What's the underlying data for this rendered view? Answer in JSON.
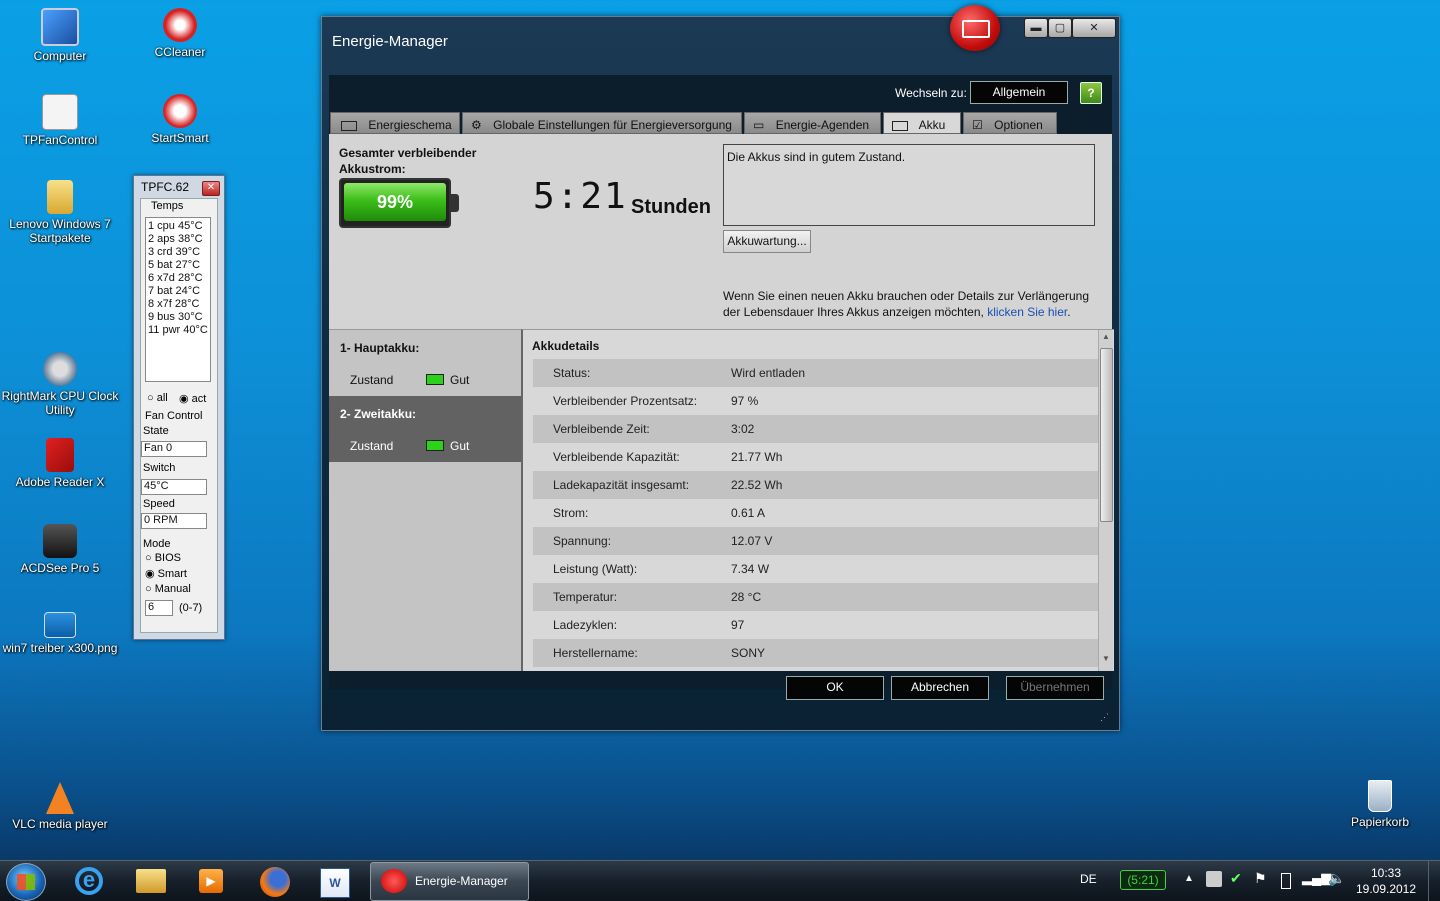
{
  "desktop": {
    "icons": [
      {
        "label": "Computer"
      },
      {
        "label": "CCleaner"
      },
      {
        "label": "TPFanControl"
      },
      {
        "label": "StartSmart"
      },
      {
        "label": "Lenovo Windows 7 Startpakete"
      },
      {
        "label": "RightMark CPU Clock Utility"
      },
      {
        "label": "Adobe Reader X"
      },
      {
        "label": "ACDSee Pro 5"
      },
      {
        "label": "win7 treiber x300.png"
      },
      {
        "label": "VLC media player"
      },
      {
        "label": "Papierkorb"
      }
    ]
  },
  "tpfc": {
    "title": "TPFC.62",
    "temps_label": "Temps",
    "temps": [
      "1 cpu 45°C",
      "2 aps 38°C",
      "3 crd 39°C",
      "5 bat 27°C",
      "6 x7d 28°C",
      "7 bat 24°C",
      "8 x7f 28°C",
      "9 bus 30°C",
      "11 pwr 40°C"
    ],
    "opt_all": "all",
    "opt_act": "act",
    "fan_control_label": "Fan Control",
    "state_label": "State",
    "state_value": "Fan 0",
    "switch_label": "Switch",
    "switch_value": "45°C",
    "speed_label": "Speed",
    "speed_value": "0 RPM",
    "mode_label": "Mode",
    "mode_bios": "BIOS",
    "mode_smart": "Smart",
    "mode_manual": "Manual",
    "manual_value": "6",
    "manual_range": "(0-7)"
  },
  "energy": {
    "title": "Energie-Manager",
    "switch_label": "Wechseln zu:",
    "switch_button": "Allgemein",
    "tabs": [
      {
        "label": "Energieschema"
      },
      {
        "label": "Globale Einstellungen für Energieversorgung"
      },
      {
        "label": "Energie-Agenden"
      },
      {
        "label": "Akku"
      },
      {
        "label": "Optionen"
      }
    ],
    "remaining_label": "Gesamter verbleibender Akkustrom:",
    "battery_percent": "99%",
    "time": "5:21",
    "time_unit": "Stunden",
    "status_text": "Die Akkus sind in gutem Zustand.",
    "maintenance_button": "Akkuwartung...",
    "info_text": "Wenn Sie einen neuen Akku brauchen oder Details zur Verlängerung der Lebensdauer Ihres Akkus anzeigen möchten,",
    "info_link": "klicken Sie hier",
    "batteries": [
      {
        "name": "1- Hauptakku:",
        "state_label": "Zustand",
        "state_value": "Gut"
      },
      {
        "name": "2- Zweitakku:",
        "state_label": "Zustand",
        "state_value": "Gut"
      }
    ],
    "details_title": "Akkudetails",
    "details": [
      {
        "k": "Status:",
        "v": "Wird entladen"
      },
      {
        "k": "Verbleibender Prozentsatz:",
        "v": "97 %"
      },
      {
        "k": "Verbleibende Zeit:",
        "v": "3:02"
      },
      {
        "k": "Verbleibende Kapazität:",
        "v": "21.77 Wh"
      },
      {
        "k": "Ladekapazität insgesamt:",
        "v": "22.52 Wh"
      },
      {
        "k": "Strom:",
        "v": "0.61 A"
      },
      {
        "k": "Spannung:",
        "v": "12.07 V"
      },
      {
        "k": "Leistung (Watt):",
        "v": "7.34 W"
      },
      {
        "k": "Temperatur:",
        "v": "28 °C"
      },
      {
        "k": "Ladezyklen:",
        "v": "97"
      },
      {
        "k": "Herstellername:",
        "v": "SONY"
      }
    ],
    "ok": "OK",
    "cancel": "Abbrechen",
    "apply": "Übernehmen"
  },
  "taskbar": {
    "active_task": "Energie-Manager",
    "lang": "DE",
    "battery_time": "(5:21)",
    "time": "10:33",
    "date": "19.09.2012"
  }
}
